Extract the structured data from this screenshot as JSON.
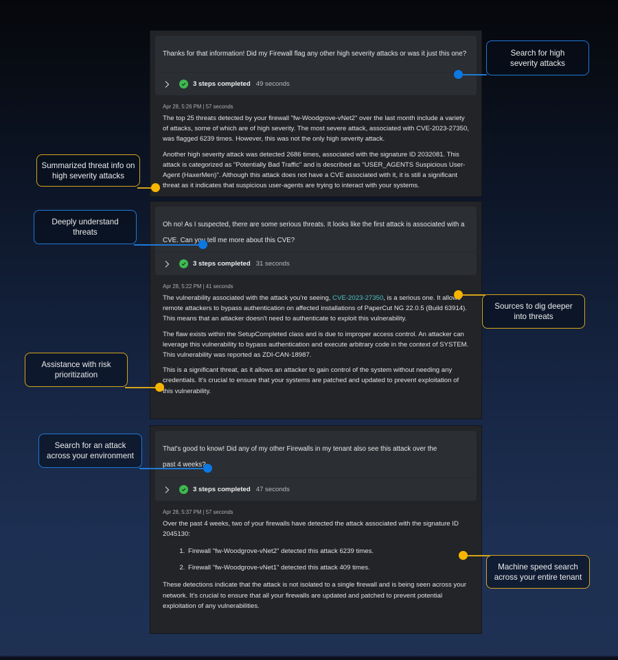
{
  "conversations": [
    {
      "prompt": "Thanks for that information! Did my Firewall flag any other high severity attacks or was it just this one?",
      "steps": {
        "label": "3 steps completed",
        "duration": "49 seconds",
        "status": "completed"
      },
      "meta": "Apr 28, 5:26 PM  |  57 seconds",
      "paragraphs": [
        "The top 25 threats detected by your firewall \"fw-Woodgrove-vNet2\" over the last month include a variety of attacks, some of which are of high severity. The most severe attack, associated with CVE-2023-27350, was flagged 6239 times. However, this was not the only high severity attack.",
        "Another high severity attack was detected 2686 times, associated with the signature ID 2032081. This attack is categorized as \"Potentially Bad Traffic\" and is described as \"USER_AGENTS Suspicious User-Agent (HaxerMen)\". Although this attack does not have a CVE associated with it, it is still a significant threat as it indicates that suspicious user-agents are trying to interact with your systems."
      ]
    },
    {
      "prompt": "Oh no! As I suspected, there are some serious threats. It looks like the first attack is associated with a CVE. Can you tell me more about this CVE?",
      "steps": {
        "label": "3 steps completed",
        "duration": "31 seconds",
        "status": "completed"
      },
      "meta": "Apr 28, 5:22 PM  |  41 seconds",
      "p1_before": "The vulnerability associated with the attack you're seeing, ",
      "p1_link": "CVE-2023-27350",
      "p1_after": ", is a serious one. It allows remote attackers to bypass authentication on affected installations of PaperCut NG 22.0.5 (Build 63914). This means that an attacker doesn't need to authenticate to exploit this vulnerability.",
      "paragraphs": [
        "The flaw exists within the SetupCompleted class and is due to improper access control. An attacker can leverage this vulnerability to bypass authentication and execute arbitrary code in the context of SYSTEM. This vulnerability was reported as ZDI-CAN-18987.",
        "This is a significant threat, as it allows an attacker to gain control of the system without needing any credentials. It's crucial to ensure that your systems are patched and updated to prevent exploitation of this vulnerability."
      ]
    },
    {
      "prompt": "That's good to know! Did any of my other Firewalls in my tenant also see this attack over the past 4 weeks?",
      "steps": {
        "label": "3 steps completed",
        "duration": "47 seconds",
        "status": "completed"
      },
      "meta": "Apr 28, 5:37 PM  |  57 seconds",
      "intro": "Over the past 4 weeks, two of your firewalls have detected the attack associated with the signature ID 2045130:",
      "list": [
        "Firewall \"fw-Woodgrove-vNet2\" detected this attack 6239 times.",
        "Firewall \"fw-Woodgrove-vNet1\" detected this attack 409 times."
      ],
      "outro": "These detections indicate that the attack is not isolated to a single firewall and is being seen across your network. It's crucial to ensure that all your firewalls are updated and patched to prevent potential exploitation of any vulnerabilities."
    }
  ],
  "callouts": {
    "search_high_severity": "Search for high severity attacks",
    "summarized_threat": "Summarized threat info on high severity attacks",
    "deeply_understand": "Deeply understand threats",
    "sources_dig_deeper": "Sources to dig deeper into threats",
    "risk_prioritization": "Assistance with risk prioritization",
    "search_attack_env": "Search for an attack across your environment",
    "machine_speed": "Machine speed search across your entire tenant"
  },
  "colors": {
    "callout_blue": "#1f7ad8",
    "callout_gold": "#d6a51b",
    "success_green": "#3fb950",
    "link_teal": "#4fc3c9"
  }
}
